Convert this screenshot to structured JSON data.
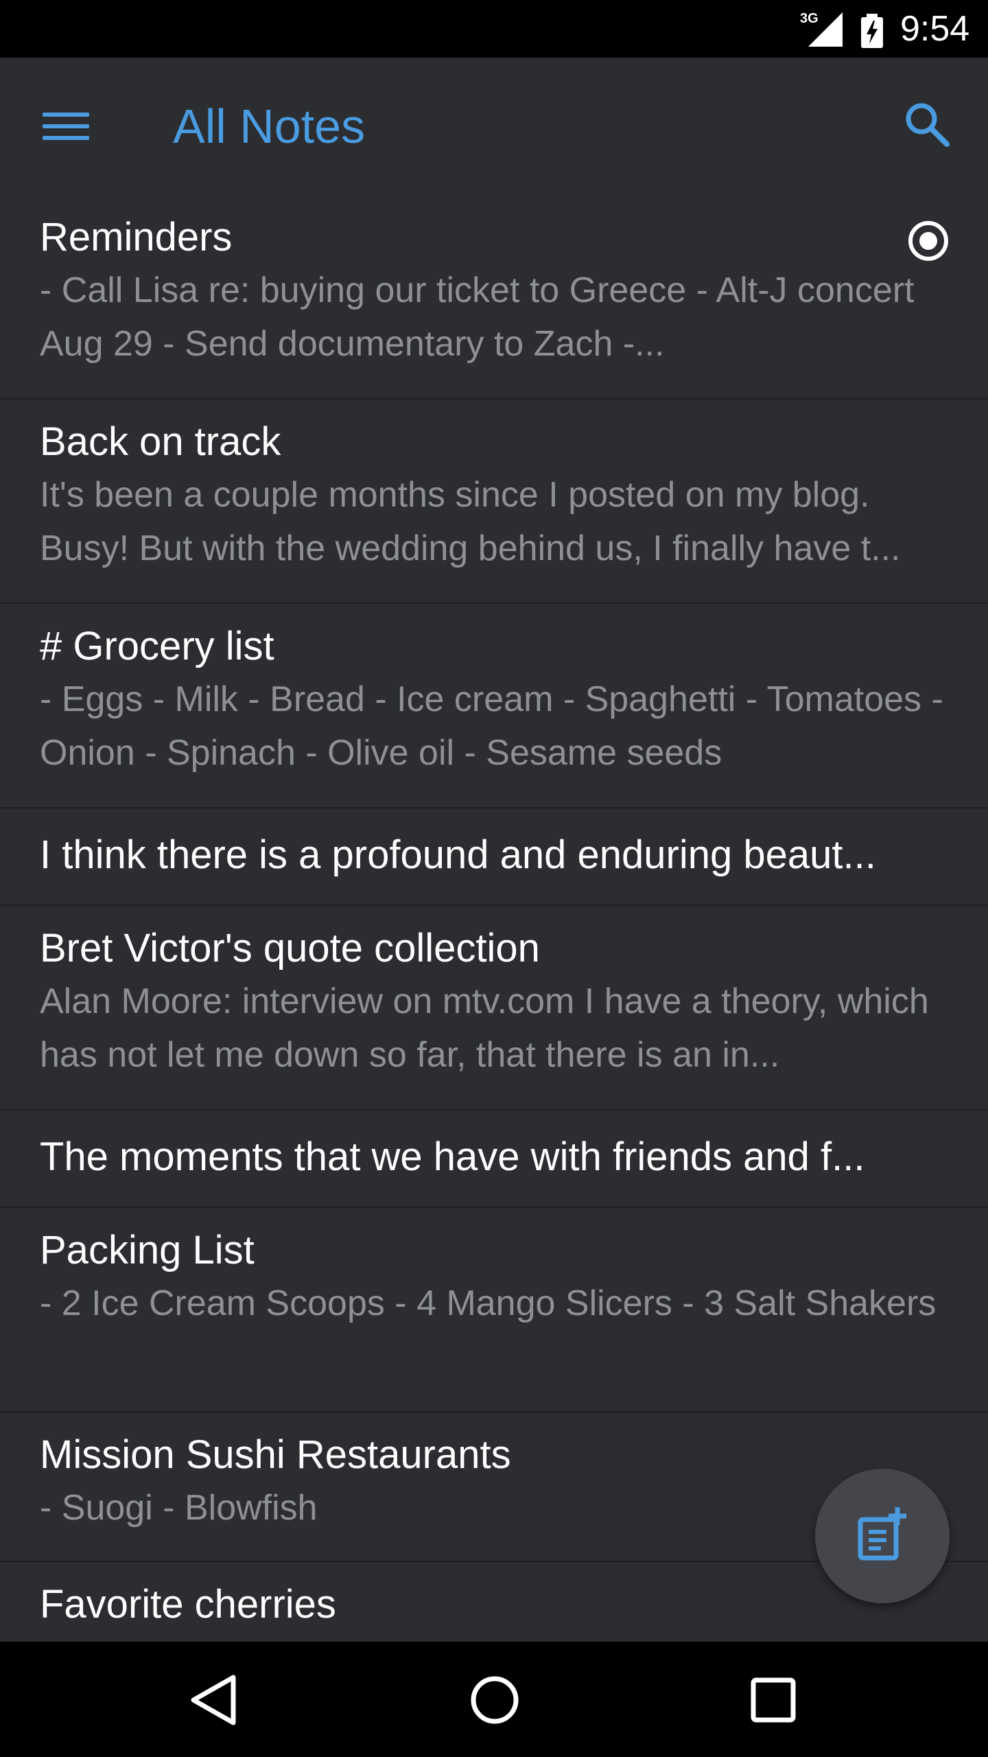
{
  "status_bar": {
    "network": "3G",
    "time": "9:54"
  },
  "app_bar": {
    "title": "All Notes",
    "menu_icon": "hamburger-menu-icon",
    "search_icon": "search-icon",
    "accent_color": "#4a9be0"
  },
  "notes": [
    {
      "title": "Reminders",
      "preview": "- Call Lisa re: buying our ticket to Greece - Alt-J concert Aug 29 - Send documentary to Zach -...",
      "has_reminder": true
    },
    {
      "title": "Back on track",
      "preview": "It's been a couple months since I posted on my blog. Busy! But with the wedding behind us, I finally have t..."
    },
    {
      "title": "# Grocery list",
      "preview": "- Eggs - Milk - Bread - Ice cream - Spaghetti - Tomatoes - Onion - Spinach - Olive oil - Sesame seeds"
    },
    {
      "title": "I think there is a profound and enduring beaut..."
    },
    {
      "title": "Bret Victor's quote collection",
      "preview": "Alan Moore: interview on mtv.com I have a theory, which has not let me down so far, that there is an in..."
    },
    {
      "title": "The moments that we have with friends and f..."
    },
    {
      "title": "Packing List",
      "preview": "- 2 Ice Cream Scoops - 4 Mango Slicers - 3 Salt Shakers"
    },
    {
      "title": "Mission Sushi Restaurants",
      "preview": "- Suogi - Blowfish"
    },
    {
      "title": "Favorite cherries"
    }
  ],
  "fab": {
    "icon": "new-note-icon"
  },
  "nav_bar": {
    "back_icon": "back-triangle-icon",
    "home_icon": "home-circle-icon",
    "recents_icon": "recents-square-icon"
  }
}
